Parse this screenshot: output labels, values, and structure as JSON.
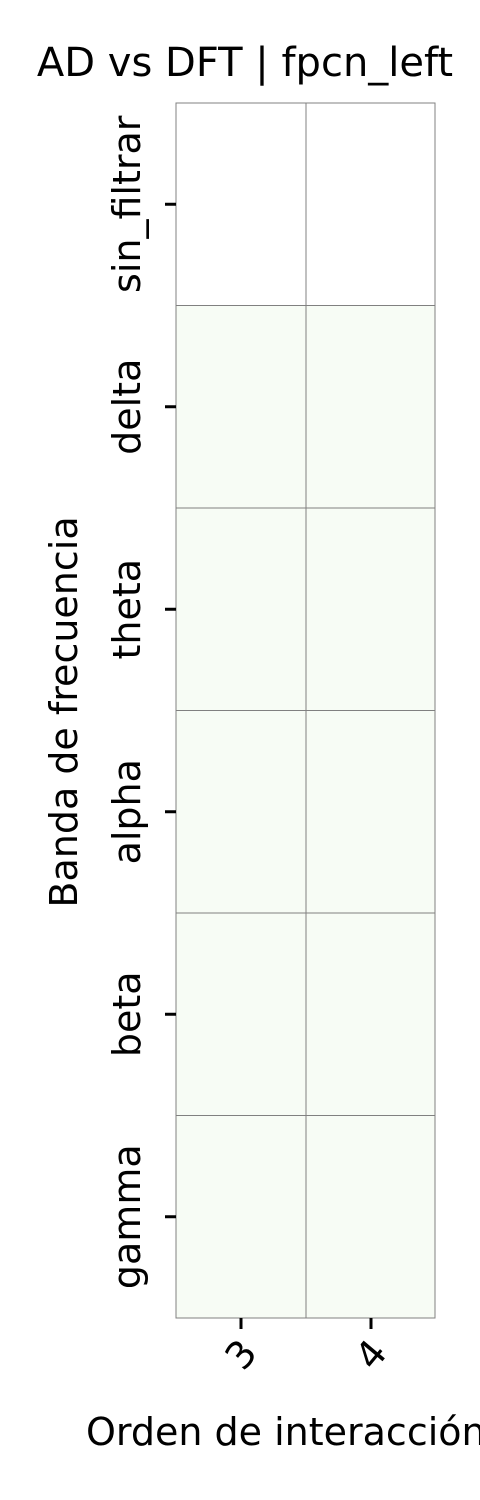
{
  "chart_data": {
    "type": "heatmap",
    "title": "AD vs DFT | fpcn_left",
    "xlabel": "Orden de interacción",
    "ylabel": "Banda de frecuencia",
    "x_categories": [
      "3",
      "4"
    ],
    "y_categories": [
      "sin_filtrar",
      "delta",
      "theta",
      "alpha",
      "beta",
      "gamma"
    ],
    "values": [
      [
        null,
        null
      ],
      [
        0.0,
        0.0
      ],
      [
        0.0,
        0.0
      ],
      [
        0.0,
        0.0
      ],
      [
        0.0,
        0.0
      ],
      [
        0.0,
        0.0
      ]
    ],
    "colors": {
      "cell_fill": "#f7fcf5",
      "missing_fill": "#ffffff",
      "grid_line": "#808080"
    },
    "grid": true
  }
}
